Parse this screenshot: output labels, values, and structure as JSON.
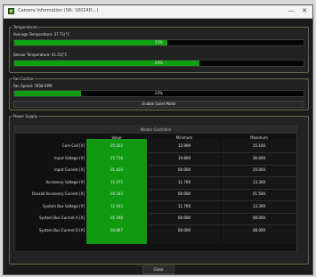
{
  "window": {
    "title": "Camera Information (SN: 16024D...)"
  },
  "temperatures": {
    "title": "Temperatures",
    "average_label": "Average Temperature: 37.71|°C",
    "average_pct": "53%",
    "average_fraction": 0.53,
    "sensor_label": "Sensor Temperature: 41.31|°C",
    "sensor_pct": "64%",
    "sensor_fraction": 0.64
  },
  "fan": {
    "title": "Fan Control",
    "speed_label": "Fan Speed: 7858 RPM",
    "pct": "23%",
    "fraction": 0.23,
    "button_label": "Enable Quiet Mode"
  },
  "power": {
    "title": "Power Supply",
    "caption": "Master Controller",
    "headers": [
      "Value",
      "Minimum",
      "Maximum"
    ],
    "rows": [
      {
        "label": "Core Cell [V]",
        "value": "05.022",
        "min": "12.909",
        "max": "15.100"
      },
      {
        "label": "Input Voltage [V]",
        "value": "25.716",
        "min": "19.800",
        "max": "36.000"
      },
      {
        "label": "Input Current [A]",
        "value": "01.429",
        "min": "00.000",
        "max": "20.000"
      },
      {
        "label": "Accessory Voltage [V]",
        "value": "11.975",
        "min": "11.700",
        "max": "13.300"
      },
      {
        "label": "Overall Accessory Current [A]",
        "value": "00.183",
        "min": "00.000",
        "max": "01.500"
      },
      {
        "label": "System Bus Voltage [V]",
        "value": "11.933",
        "min": "11.700",
        "max": "13.300"
      },
      {
        "label": "System Bus Current A [A]",
        "value": "01.398",
        "min": "00.000",
        "max": "08.000"
      },
      {
        "label": "System Bus Current B [A]",
        "value": "04.867",
        "min": "00.000",
        "max": "08.000"
      }
    ]
  },
  "footer": {
    "close_label": "Close"
  }
}
